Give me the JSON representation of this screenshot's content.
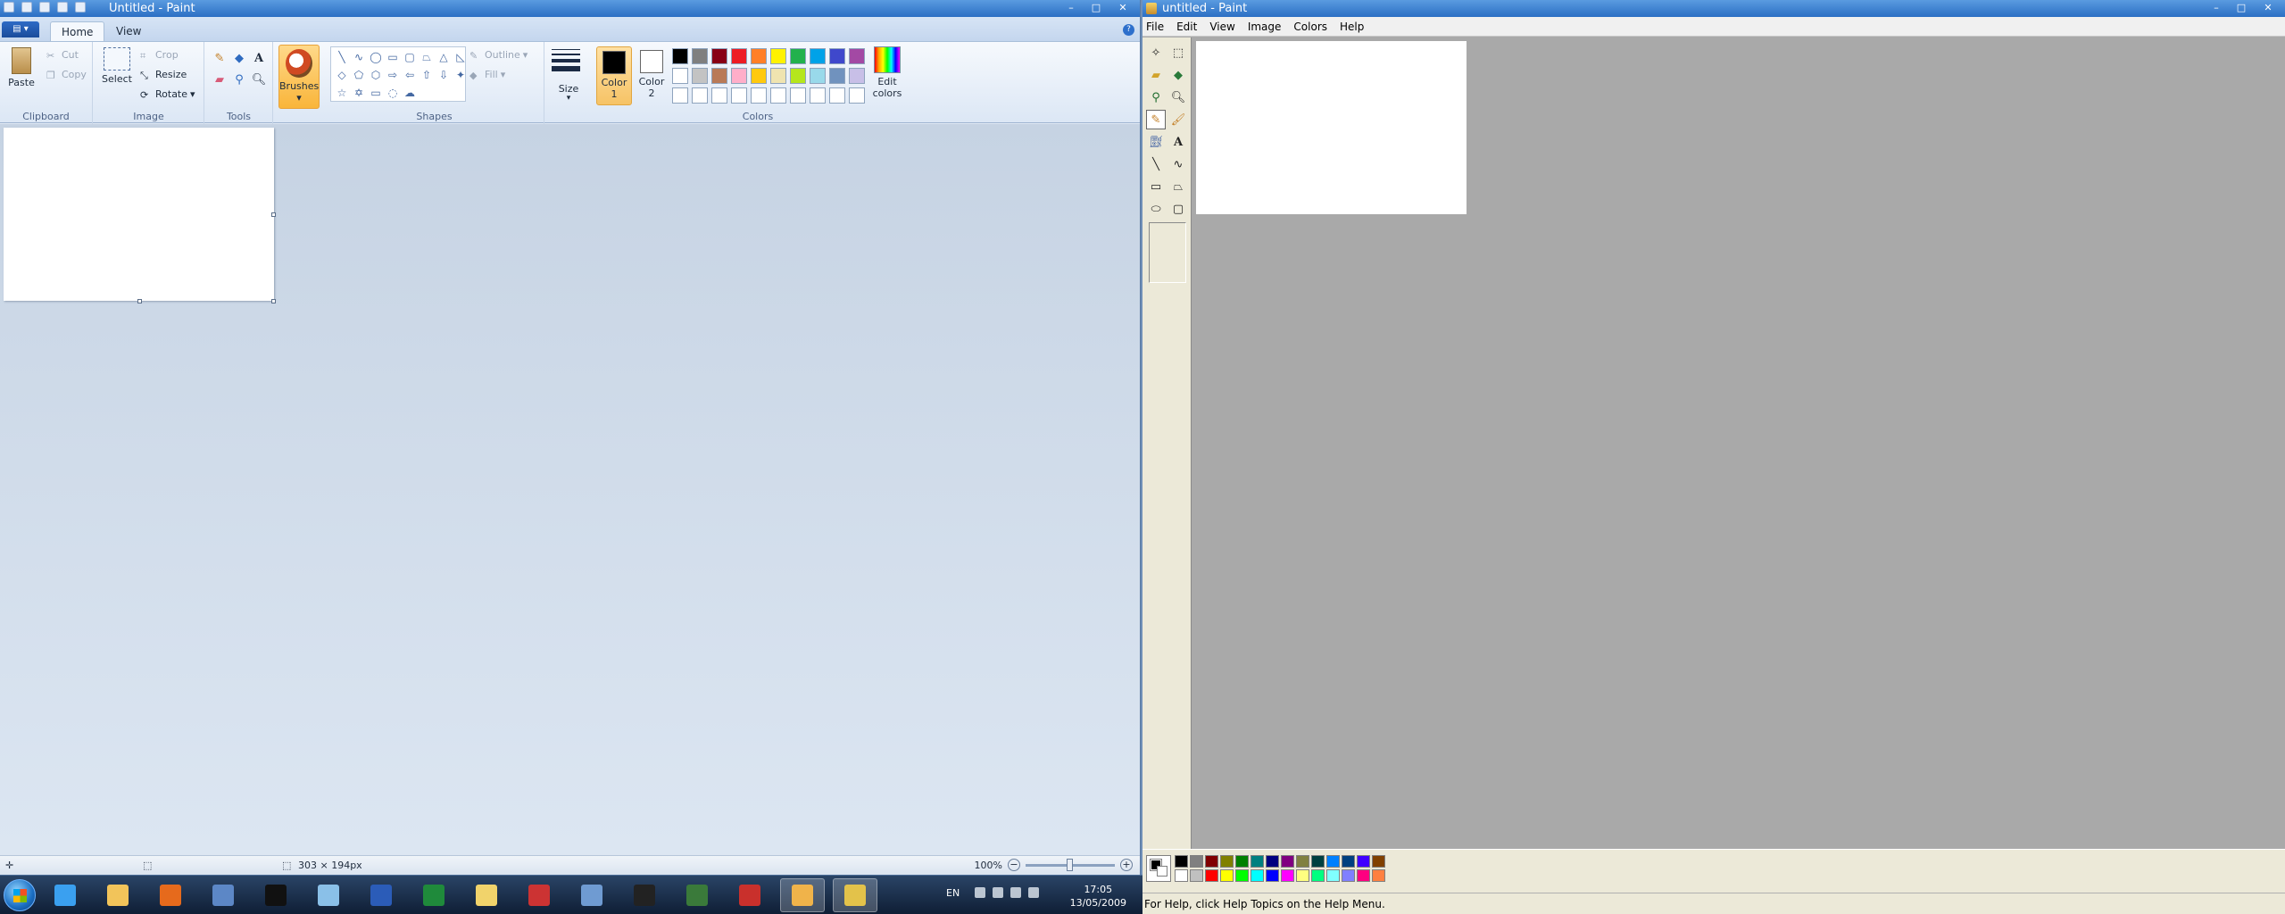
{
  "left_window": {
    "title": "Untitled - Paint",
    "controls": {
      "minimize": "–",
      "maximize": "□",
      "close": "✕"
    },
    "tabs": [
      "Home",
      "View"
    ],
    "help": "?",
    "ribbon": {
      "clipboard": {
        "label": "Clipboard",
        "paste": "Paste",
        "cut": "Cut",
        "copy": "Copy"
      },
      "image": {
        "label": "Image",
        "select": "Select",
        "crop": "Crop",
        "resize": "Resize",
        "rotate": "Rotate"
      },
      "tools": {
        "label": "Tools"
      },
      "brushes": "Brushes",
      "shapes": {
        "label": "Shapes",
        "outline": "Outline",
        "fill": "Fill"
      },
      "size": "Size",
      "colors": {
        "label": "Colors",
        "color1": "Color",
        "color1_num": "1",
        "color2": "Color",
        "color2_num": "2",
        "edit": "Edit colors",
        "palette": [
          "#000000",
          "#7f7f7f",
          "#880015",
          "#ed1c24",
          "#ff7f27",
          "#fff200",
          "#22b14c",
          "#00a2e8",
          "#3f48cc",
          "#a349a4",
          "#ffffff",
          "#c3c3c3",
          "#b97a57",
          "#ffaec9",
          "#ffc90e",
          "#efe4b0",
          "#b5e61d",
          "#99d9ea",
          "#7092be",
          "#c8bfe7",
          "#ffffff",
          "#ffffff",
          "#ffffff",
          "#ffffff",
          "#ffffff",
          "#ffffff",
          "#ffffff",
          "#ffffff",
          "#ffffff",
          "#ffffff"
        ]
      }
    },
    "status": {
      "size": "303 × 194px",
      "zoom": "100%"
    }
  },
  "right_window": {
    "title": "untitled - Paint",
    "menu": [
      "File",
      "Edit",
      "View",
      "Image",
      "Colors",
      "Help"
    ],
    "palette": [
      "#000000",
      "#808080",
      "#800000",
      "#808000",
      "#008000",
      "#008080",
      "#000080",
      "#800080",
      "#808040",
      "#004040",
      "#0080ff",
      "#004080",
      "#4000ff",
      "#804000",
      "#ffffff",
      "#c0c0c0",
      "#ff0000",
      "#ffff00",
      "#00ff00",
      "#00ffff",
      "#0000ff",
      "#ff00ff",
      "#ffff80",
      "#00ff80",
      "#80ffff",
      "#8080ff",
      "#ff0080",
      "#ff8040"
    ],
    "status": "For Help, click Help Topics on the Help Menu."
  },
  "taskbar": {
    "lang": "EN",
    "time": "17:05",
    "date": "13/05/2009",
    "apps": [
      {
        "name": "ie-icon",
        "color": "#3aa0f0"
      },
      {
        "name": "mail-icon",
        "color": "#f2c45a"
      },
      {
        "name": "firefox-icon",
        "color": "#e66a1c"
      },
      {
        "name": "computer-icon",
        "color": "#5c87c6"
      },
      {
        "name": "cmd-icon",
        "color": "#111111"
      },
      {
        "name": "notes-icon",
        "color": "#8ac0e8"
      },
      {
        "name": "word-icon",
        "color": "#2b5cb8"
      },
      {
        "name": "excel-icon",
        "color": "#1f8a3b"
      },
      {
        "name": "folder-icon",
        "color": "#f1d36b"
      },
      {
        "name": "network-icon",
        "color": "#cc3333"
      },
      {
        "name": "user-icon",
        "color": "#6f9bd2"
      },
      {
        "name": "blackberry-icon",
        "color": "#222222"
      },
      {
        "name": "chart-icon",
        "color": "#3a7a3a"
      },
      {
        "name": "toolbox-icon",
        "color": "#c9302c"
      },
      {
        "name": "paint-new-icon",
        "color": "#f0b34a"
      },
      {
        "name": "paint-old-icon",
        "color": "#e3c24a"
      }
    ]
  }
}
